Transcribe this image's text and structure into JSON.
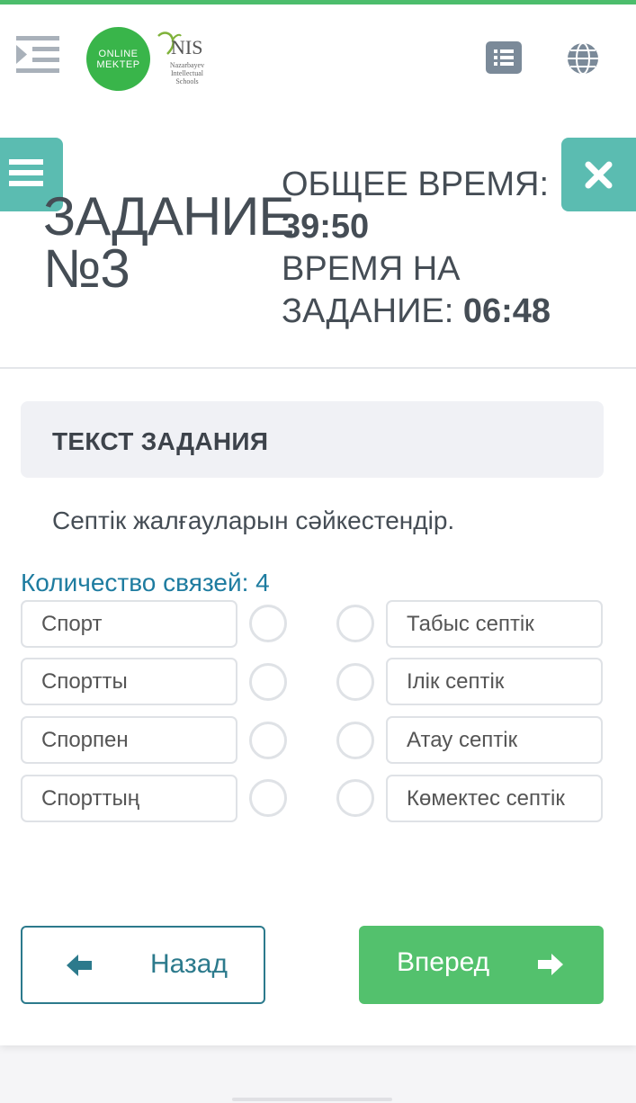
{
  "header": {
    "online_line1": "ONLINE",
    "online_line2": "MEKTEP",
    "nis_word": "NIS",
    "nis_sub": "Nazarbayev Intellectual Schools",
    "icons": [
      "indent-menu-icon",
      "list-icon",
      "globe-icon"
    ],
    "accent_color": "#4cbd6c"
  },
  "task": {
    "title_line1": "ЗАДАНИЕ",
    "title_line2": "№3",
    "total_time_label": "ОБЩЕЕ ВРЕМЯ:",
    "total_time_value": "39:50",
    "task_time_label_line1": "ВРЕМЯ НА",
    "task_time_label_line2": "ЗАДАНИЕ:",
    "task_time_value": "06:48"
  },
  "question": {
    "box_title": "ТЕКСТ ЗАДАНИЯ",
    "text": "Септік жалғауларын сәйкестендір.",
    "link_count": "Количество связей: 4"
  },
  "left_items": [
    "Спорт",
    "Спортты",
    "Спорпен",
    "Спорттың"
  ],
  "right_items": [
    "Табыс септік",
    "Ілік септік",
    "Атау септік",
    "Көмектес септік"
  ],
  "nav": {
    "back_label": "Назад",
    "next_label": "Вперед",
    "back_color": "#2c7a8c",
    "next_color": "#53c16d"
  },
  "side_buttons": {
    "menu_icon": "hamburger-icon",
    "close_icon": "close-icon",
    "color": "#5bbcb1"
  }
}
